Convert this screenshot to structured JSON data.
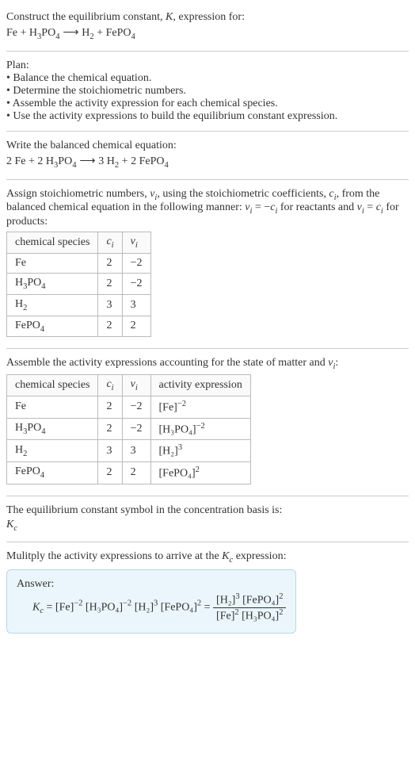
{
  "intro": {
    "line1": "Construct the equilibrium constant, ",
    "Kword": "K",
    "line1b": ", expression for:"
  },
  "reaction_unbalanced": {
    "fe": "Fe",
    "plus1": " + ",
    "h3po4": "H",
    "h3po4_sub1": "3",
    "h3po4_mid": "PO",
    "h3po4_sub2": "4",
    "arrow": "  ⟶  ",
    "h2": "H",
    "h2_sub": "2",
    "plus2": " + ",
    "fepo4": "FePO",
    "fepo4_sub": "4"
  },
  "plan": {
    "title": "Plan:",
    "items": [
      "• Balance the chemical equation.",
      "• Determine the stoichiometric numbers.",
      "• Assemble the activity expression for each chemical species.",
      "• Use the activity expressions to build the equilibrium constant expression."
    ]
  },
  "balanced_intro": "Write the balanced chemical equation:",
  "reaction_balanced": {
    "c_fe": "2 ",
    "fe": "Fe",
    "plus1": " + ",
    "c_h3po4": "2 ",
    "h3po4": "H",
    "h3po4_sub1": "3",
    "h3po4_mid": "PO",
    "h3po4_sub2": "4",
    "arrow": "  ⟶  ",
    "c_h2": "3 ",
    "h2": "H",
    "h2_sub": "2",
    "plus2": " + ",
    "c_fepo4": "2 ",
    "fepo4": "FePO",
    "fepo4_sub": "4"
  },
  "stoich_intro": {
    "a": "Assign stoichiometric numbers, ",
    "nu": "ν",
    "i": "i",
    "b": ", using the stoichiometric coefficients, ",
    "c": "c",
    "d": ", from the balanced chemical equation in the following manner: ",
    "eq1a": "ν",
    "eq1b": " = −",
    "eq1c": "c",
    "e": " for reactants and ",
    "eq2a": "ν",
    "eq2b": " = ",
    "eq2c": "c",
    "f": " for products:"
  },
  "table1": {
    "headers": {
      "species": "chemical species",
      "ci": "c",
      "ci_sub": "i",
      "nui": "ν",
      "nui_sub": "i"
    },
    "rows": [
      {
        "name": "Fe",
        "sub1": "",
        "mid": "",
        "sub2": "",
        "ci": "2",
        "nui": "−2"
      },
      {
        "name": "H",
        "sub1": "3",
        "mid": "PO",
        "sub2": "4",
        "ci": "2",
        "nui": "−2"
      },
      {
        "name": "H",
        "sub1": "2",
        "mid": "",
        "sub2": "",
        "ci": "3",
        "nui": "3"
      },
      {
        "name": "FePO",
        "sub1": "4",
        "mid": "",
        "sub2": "",
        "ci": "2",
        "nui": "2"
      }
    ]
  },
  "activity_intro": {
    "a": "Assemble the activity expressions accounting for the state of matter and ",
    "nu": "ν",
    "i": "i",
    "b": ":"
  },
  "table2": {
    "headers": {
      "species": "chemical species",
      "ci": "c",
      "ci_sub": "i",
      "nui": "ν",
      "nui_sub": "i",
      "activity": "activity expression"
    },
    "rows": [
      {
        "name": "Fe",
        "sub1": "",
        "mid": "",
        "sub2": "",
        "ci": "2",
        "nui": "−2",
        "act_open": "[Fe]",
        "act_exp": "−2"
      },
      {
        "name": "H",
        "sub1": "3",
        "mid": "PO",
        "sub2": "4",
        "ci": "2",
        "nui": "−2",
        "act_open": "[H₃PO₄]",
        "act_exp": "−2"
      },
      {
        "name": "H",
        "sub1": "2",
        "mid": "",
        "sub2": "",
        "ci": "3",
        "nui": "3",
        "act_open": "[H₂]",
        "act_exp": "3"
      },
      {
        "name": "FePO",
        "sub1": "4",
        "mid": "",
        "sub2": "",
        "ci": "2",
        "nui": "2",
        "act_open": "[FePO₄]",
        "act_exp": "2"
      }
    ]
  },
  "kc_intro": "The equilibrium constant symbol in the concentration basis is:",
  "kc_symbol": {
    "K": "K",
    "c": "c"
  },
  "multiply_intro": {
    "a": "Mulitply the activity expressions to arrive at the ",
    "K": "K",
    "c": "c",
    "b": " expression:"
  },
  "answer": {
    "label": "Answer:",
    "lhs": {
      "K": "K",
      "c": "c",
      "eq": " = "
    },
    "mid": {
      "t1": "[Fe]",
      "e1": "−2",
      "t2": " [H₃PO₄]",
      "e2": "−2",
      "t3": " [H₂]",
      "e3": "3",
      "t4": " [FePO₄]",
      "e4": "2",
      "eq": " = "
    },
    "frac": {
      "num_a": "[H₂]",
      "num_ae": "3",
      "num_b": " [FePO₄]",
      "num_be": "2",
      "den_a": "[Fe]",
      "den_ae": "2",
      "den_b": " [H₃PO₄]",
      "den_be": "2"
    }
  }
}
